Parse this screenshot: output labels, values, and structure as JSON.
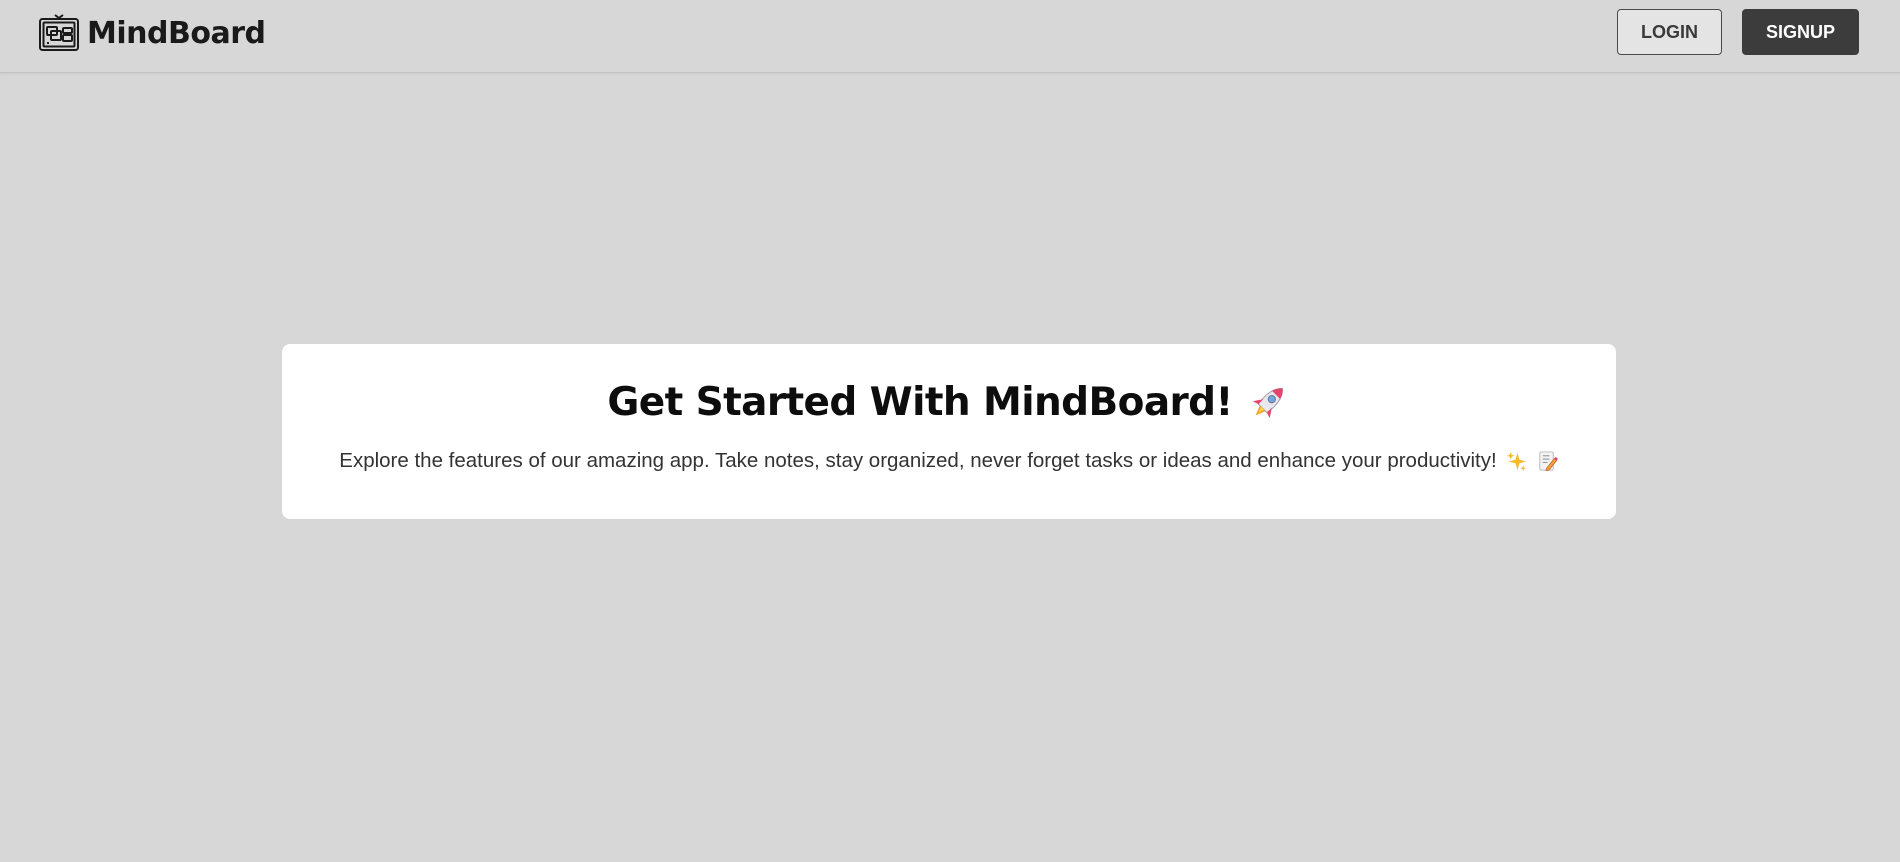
{
  "header": {
    "brand_name": "MindBoard",
    "brand_icon": "whiteboard-icon",
    "login_label": "LOGIN",
    "signup_label": "SIGNUP"
  },
  "hero": {
    "title": "Get Started With MindBoard!",
    "title_icon": "rocket-emoji",
    "subtitle": "Explore the features of our amazing app. Take notes, stay organized, never forget tasks or ideas and enhance your productivity!",
    "subtitle_icons": [
      "sparkles-emoji",
      "memo-emoji"
    ]
  },
  "colors": {
    "page_background": "#d7d7d7",
    "card_background": "#ffffff",
    "signup_button": "#3c3c3c",
    "login_button": "#e4e4e4",
    "text_dark": "#1a1a1a"
  }
}
